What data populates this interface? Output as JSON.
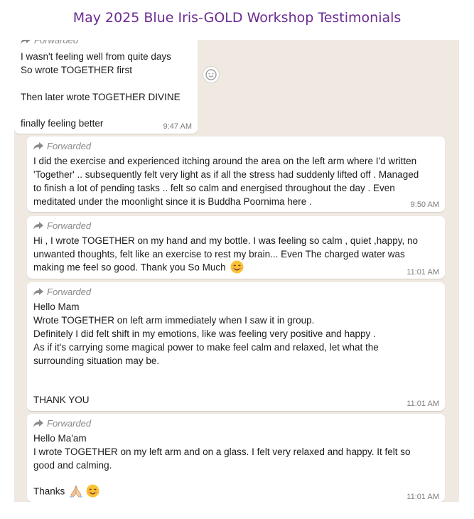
{
  "page": {
    "title": "May 2025 Blue Iris-GOLD Workshop Testimonials"
  },
  "forwarded_label": "Forwarded",
  "messages": [
    {
      "lines": [
        "I wasn't feeling well from quite days",
        "So wrote TOGETHER first",
        "",
        "Then later wrote TOGETHER DIVINE",
        "",
        "finally feeling better"
      ],
      "time": "9:47 AM"
    },
    {
      "lines": [
        "I did the exercise and experienced itching around the area on the left arm where I'd written",
        "'Together' .. subsequently felt very light as if all the stress had suddenly lifted off . Managed",
        "to finish a lot of pending tasks .. felt so calm and energised throughout the day . Even",
        "meditated under the moonlight since it is Buddha Poornima here ."
      ],
      "time": "9:50 AM"
    },
    {
      "lines": [
        "Hi , I wrote TOGETHER on my hand and my bottle. I was feeling so calm , quiet ,happy, no",
        "unwanted thoughts,  felt like an exercise to rest my brain... Even The charged water was",
        "making me feel so good.  Thank you So Much"
      ],
      "time": "11:01 AM"
    },
    {
      "lines": [
        "Hello Mam",
        "Wrote TOGETHER on left arm immediately when I saw it in group.",
        "Definitely I did felt shift in my emotions, like was feeling very positive and happy .",
        "As if it's carrying some magical power to make feel calm and relaxed, let what the",
        "surrounding situation may be.",
        "",
        "",
        "THANK YOU"
      ],
      "time": "11:01 AM"
    },
    {
      "lines": [
        "Hello Ma'am",
        "I wrote TOGETHER on my left arm and on a glass. I felt very relaxed and happy. It felt so",
        "good and calming.",
        "",
        "Thanks"
      ],
      "time": "11:01 AM"
    }
  ],
  "icons": {
    "forward": "forward-arrow-icon",
    "emoji_reaction": "smiley-reaction-icon",
    "smiling_emoji": "smiling-face-emoji",
    "folded_hands": "folded-hands-emoji"
  },
  "colors": {
    "title": "#6a2c91",
    "chat_background": "#efe9e2",
    "bubble": "#ffffff"
  }
}
